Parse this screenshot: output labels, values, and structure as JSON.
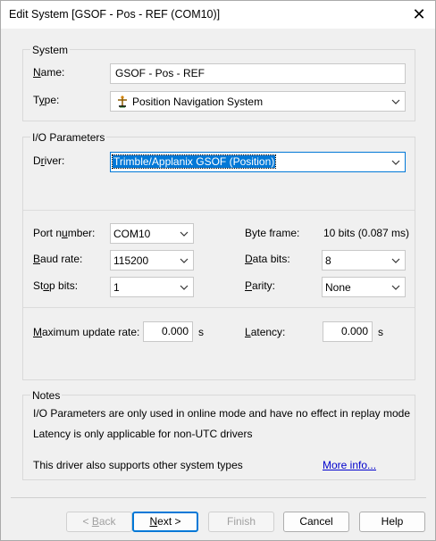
{
  "window": {
    "title": "Edit System [GSOF - Pos - REF (COM10)]",
    "close_glyph": "✕"
  },
  "system": {
    "group_label": "System",
    "name_label_pre": "",
    "name_label_ul": "N",
    "name_label_post": "ame:",
    "name_value": "GSOF - Pos - REF",
    "type_label_pre": "T",
    "type_label_ul": "y",
    "type_label_post": "pe:",
    "type_value": "Position Navigation System",
    "type_icon": "antenna-icon"
  },
  "io": {
    "group_label": "I/O Parameters",
    "driver_label_pre": "D",
    "driver_label_ul": "r",
    "driver_label_post": "iver:",
    "driver_value": "Trimble/Applanix GSOF (Position)",
    "port_label_pre": "Port n",
    "port_label_ul": "u",
    "port_label_post": "mber:",
    "port_value": "COM10",
    "baud_label_pre": "",
    "baud_label_ul": "B",
    "baud_label_post": "aud rate:",
    "baud_value": "115200",
    "stop_label_pre": "St",
    "stop_label_ul": "o",
    "stop_label_post": "p bits:",
    "stop_value": "1",
    "byte_frame_label": "Byte frame:",
    "byte_frame_value": "10 bits (0.087 ms)",
    "data_bits_label_pre": "",
    "data_bits_label_ul": "D",
    "data_bits_label_post": "ata bits:",
    "data_bits_value": "8",
    "parity_label_pre": "",
    "parity_label_ul": "P",
    "parity_label_post": "arity:",
    "parity_value": "None",
    "max_rate_label_pre": "",
    "max_rate_label_ul": "M",
    "max_rate_label_post": "aximum update rate:",
    "max_rate_value": "0.000",
    "max_rate_unit": "s",
    "latency_label_pre": "",
    "latency_label_ul": "L",
    "latency_label_post": "atency:",
    "latency_value": "0.000",
    "latency_unit": "s"
  },
  "notes": {
    "group_label": "Notes",
    "line1": "I/O Parameters are only used in online mode and have no effect in replay mode",
    "line2": "Latency is only applicable for non-UTC drivers",
    "line3": "This driver also supports other system types",
    "more_info": "More info..."
  },
  "buttons": {
    "back_pre": "< ",
    "back_ul": "B",
    "back_post": "ack",
    "next_pre": "",
    "next_ul": "N",
    "next_post": "ext >",
    "finish": "Finish",
    "cancel": "Cancel",
    "help": "Help"
  }
}
